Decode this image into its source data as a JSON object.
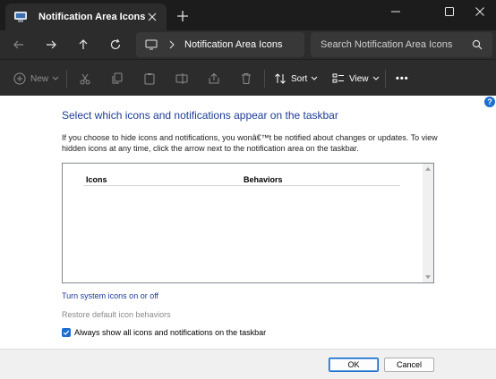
{
  "window": {
    "tab_title": "Notification Area Icons",
    "tab_icon": "control-panel-icon",
    "close_tab_icon": "close-icon",
    "new_tab_icon": "plus-icon",
    "controls": [
      "minimize-icon",
      "maximize-icon",
      "close-icon"
    ]
  },
  "navigation": {
    "buttons": [
      "back-icon",
      "forward-icon",
      "up-icon",
      "refresh-icon"
    ],
    "address": "Notification Area Icons",
    "search_placeholder": "Search Notification Area Icons"
  },
  "command_bar": {
    "new_label": "New",
    "sort_label": "Sort",
    "view_label": "View",
    "more_label": "•••",
    "icons": [
      "cut-icon",
      "copy-icon",
      "paste-icon",
      "rename-icon",
      "share-icon",
      "delete-icon"
    ]
  },
  "content": {
    "heading": "Select which icons and notifications appear on the taskbar",
    "description": "If you choose to hide icons and notifications, you wonâ€™t be notified about changes or updates. To view hidden icons at any time, click the arrow next to the notification area on the taskbar.",
    "columns": [
      "Icons",
      "Behaviors"
    ],
    "link_system_icons": "Turn system icons on or off",
    "link_restore": "Restore default icon behaviors",
    "checkbox_label": "Always show all icons and notifications on the taskbar",
    "checkbox_checked": true,
    "help": "?"
  },
  "footer": {
    "ok": "OK",
    "cancel": "Cancel"
  },
  "colors": {
    "accent": "#1c6dd0",
    "heading": "#1e3c96",
    "chrome": "#2c2c2c"
  }
}
